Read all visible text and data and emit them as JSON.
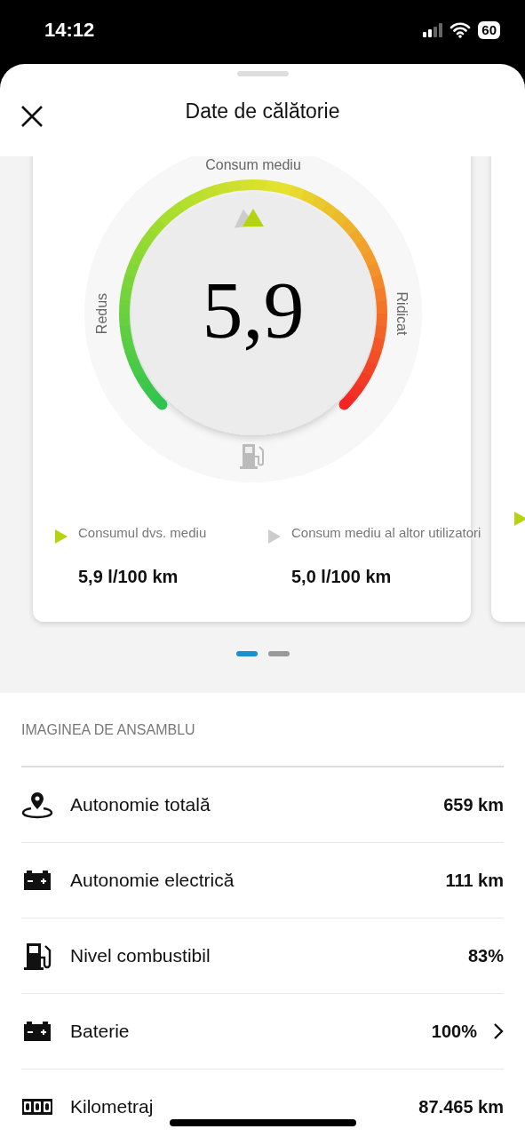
{
  "status_bar": {
    "time": "14:12",
    "battery": "60"
  },
  "header": {
    "title": "Date de călătorie"
  },
  "gauge": {
    "label_top": "Consum mediu",
    "label_low": "Redus",
    "label_high": "Ridicat",
    "value": "5,9"
  },
  "legend": [
    {
      "label": "Consumul dvs. mediu",
      "value": "5,9 l/100 km",
      "color": "#b5d30f"
    },
    {
      "label": "Consum mediu al altor utilizatori",
      "value": "5,0 l/100 km",
      "color": "#cccccc"
    }
  ],
  "pager": [
    {
      "selected": true
    },
    {
      "selected": false
    }
  ],
  "overview": {
    "heading": "IMAGINEA DE ANSAMBLU",
    "rows": [
      {
        "kind": "pin",
        "label": "Autonomie totală",
        "value": "659 km",
        "chevron": false
      },
      {
        "kind": "battery",
        "label": "Autonomie electrică",
        "value": "111 km",
        "chevron": false
      },
      {
        "kind": "fuel",
        "label": "Nivel combustibil",
        "value": "83%",
        "chevron": false
      },
      {
        "kind": "battery",
        "label": "Baterie",
        "value": "100%",
        "chevron": true
      },
      {
        "kind": "odometer",
        "label": "Kilometraj",
        "value": "87.465 km",
        "chevron": false
      }
    ]
  }
}
